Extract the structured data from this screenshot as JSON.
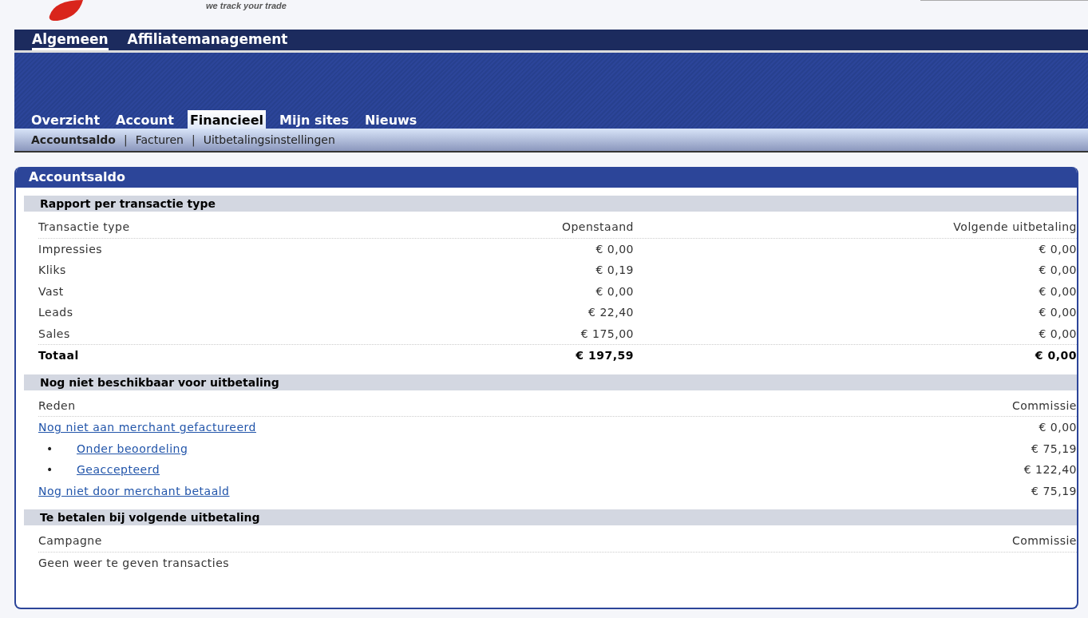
{
  "header": {
    "tagline": "we track your trade"
  },
  "main_nav": [
    {
      "label": "Algemeen",
      "selected": true
    },
    {
      "label": "Affiliatemanagement",
      "selected": false
    }
  ],
  "tabs": [
    {
      "label": "Overzicht",
      "selected": false
    },
    {
      "label": "Account",
      "selected": false
    },
    {
      "label": "Financieel",
      "selected": true
    },
    {
      "label": "Mijn sites",
      "selected": false
    },
    {
      "label": "Nieuws",
      "selected": false
    }
  ],
  "sub_nav": {
    "separator": "|",
    "items": [
      {
        "label": "Accountsaldo",
        "selected": true
      },
      {
        "label": "Facturen",
        "selected": false
      },
      {
        "label": "Uitbetalingsinstellingen",
        "selected": false
      }
    ]
  },
  "panel": {
    "title": "Accountsaldo",
    "report": {
      "title": "Rapport per transactie type",
      "columns": [
        "Transactie type",
        "Openstaand",
        "Volgende uitbetaling"
      ],
      "rows": [
        [
          "Impressies",
          "€ 0,00",
          "€ 0,00"
        ],
        [
          "Kliks",
          "€ 0,19",
          "€ 0,00"
        ],
        [
          "Vast",
          "€ 0,00",
          "€ 0,00"
        ],
        [
          "Leads",
          "€ 22,40",
          "€ 0,00"
        ],
        [
          "Sales",
          "€ 175,00",
          "€ 0,00"
        ]
      ],
      "total": [
        "Totaal",
        "€ 197,59",
        "€ 0,00"
      ]
    },
    "pending": {
      "title": "Nog niet beschikbaar voor uitbetaling",
      "columns": [
        "Reden",
        "Commissie"
      ],
      "rows": [
        {
          "kind": "link",
          "label": "Nog niet aan merchant gefactureerd",
          "amount": "€ 0,00"
        },
        {
          "kind": "sub",
          "marker": "•",
          "label": "Onder beoordeling",
          "amount": "€ 75,19"
        },
        {
          "kind": "sub",
          "marker": "•",
          "label": "Geaccepteerd",
          "amount": "€ 122,40"
        },
        {
          "kind": "link",
          "label": "Nog niet door merchant betaald",
          "amount": "€ 75,19"
        }
      ]
    },
    "payout": {
      "title": "Te betalen bij volgende uitbetaling",
      "columns": [
        "Campagne",
        "Commissie"
      ],
      "empty": "Geen weer te geven transacties"
    }
  }
}
